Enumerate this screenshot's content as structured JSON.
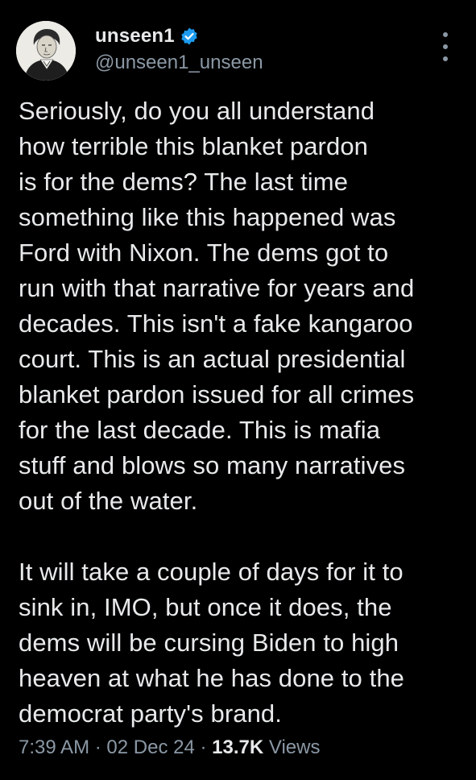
{
  "author": {
    "display_name": "unseen1",
    "handle": "@unseen1_unseen",
    "verified": true,
    "avatar_icon": "portrait-avatar-icon"
  },
  "tweet": {
    "paragraphs": [
      "Seriously, do you all understand\nhow terrible this blanket pardon\nis for the dems?  The last time\nsomething like this happened was\nFord with Nixon.   The dems got to\nrun with that narrative for years and\ndecades.  This isn't a fake kangaroo\ncourt. This is an actual presidential\nblanket pardon issued for all crimes\nfor the last decade.  This is mafia\nstuff and blows so many narratives\nout of the water.",
      "It will take a couple of days for it to\nsink in, IMO, but once it does, the\ndems will be cursing Biden to high\nheaven at what he has done to the\ndemocrat party's brand."
    ]
  },
  "meta": {
    "time": "7:39 AM",
    "separator": "·",
    "date": "02 Dec 24",
    "views_count": "13.7K",
    "views_label": "Views"
  },
  "colors": {
    "background": "#000000",
    "text_primary": "#e7e9ea",
    "text_secondary": "#8b98a5",
    "verified_blue": "#1d9bf0"
  },
  "icons": {
    "more": "more-vertical-icon",
    "verified": "verified-badge-icon"
  }
}
